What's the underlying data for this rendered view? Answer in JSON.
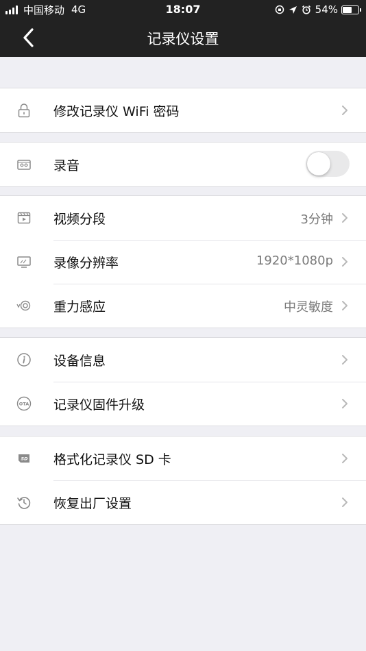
{
  "status_bar": {
    "carrier": "中国移动",
    "network": "4G",
    "time": "18:07",
    "battery": "54%"
  },
  "nav": {
    "title": "记录仪设置",
    "back_icon": "chevron-left-icon"
  },
  "colors": {
    "header_bg": "#222222",
    "page_bg": "#efeff4",
    "value_text": "#7a7a7a"
  },
  "groups": [
    {
      "rows": [
        {
          "icon": "lock-icon",
          "label": "修改记录仪 WiFi 密码"
        }
      ]
    },
    {
      "rows": [
        {
          "icon": "cassette-icon",
          "label": "录音",
          "toggle": false
        }
      ]
    },
    {
      "rows": [
        {
          "icon": "video-clip-icon",
          "label": "视频分段",
          "value": "3分钟"
        },
        {
          "icon": "monitor-icon",
          "label": "录像分辨率",
          "value": "1920*1080p"
        },
        {
          "icon": "gravity-sensor-icon",
          "label": "重力感应",
          "value": "中灵敏度"
        }
      ]
    },
    {
      "rows": [
        {
          "icon": "info-icon",
          "label": "设备信息"
        },
        {
          "icon": "ota-icon",
          "label": "记录仪固件升级",
          "icon_text": "OTA"
        }
      ]
    },
    {
      "rows": [
        {
          "icon": "sd-card-icon",
          "label": "格式化记录仪 SD 卡",
          "icon_text": "SD"
        },
        {
          "icon": "restore-icon",
          "label": "恢复出厂设置"
        }
      ]
    }
  ]
}
